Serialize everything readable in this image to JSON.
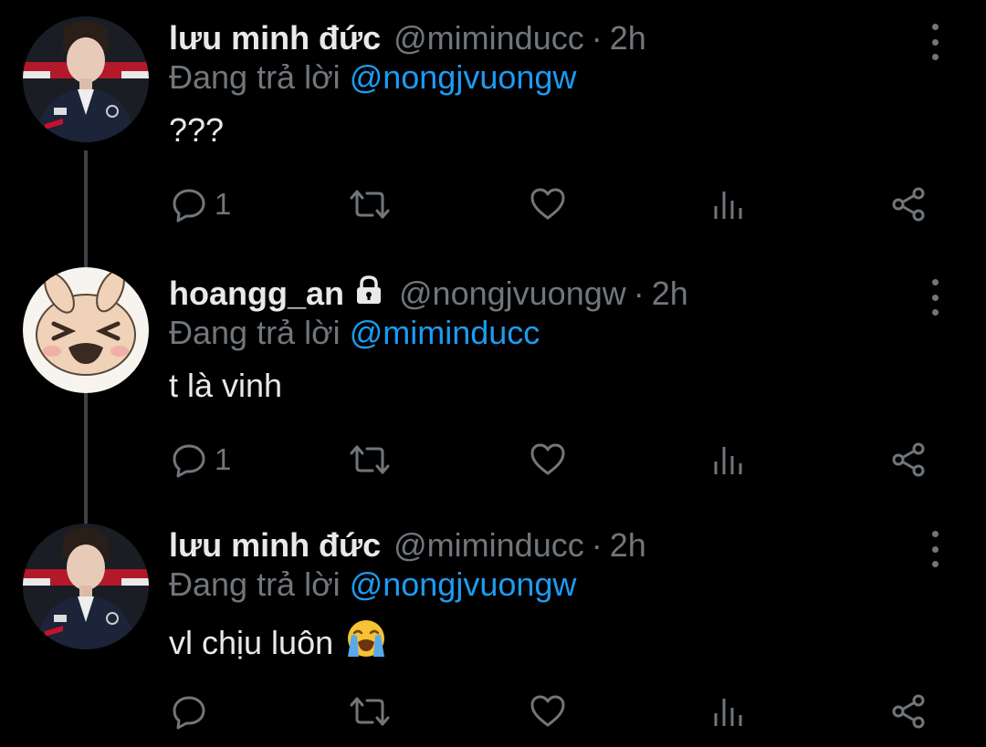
{
  "tweets": [
    {
      "name": "lưu minh đức",
      "handle": "@miminducc",
      "separator": "·",
      "time": "2h",
      "reply_prefix": "Đang trả lời",
      "reply_to": "@nongjvuongw",
      "text": "???",
      "reply_count": "1",
      "locked": false,
      "avatar": "avatar-photo-person"
    },
    {
      "name": "hoangg_an",
      "handle": "@nongjvuongw",
      "separator": "·",
      "time": "2h",
      "reply_prefix": "Đang trả lời",
      "reply_to": "@miminducc",
      "text": "t là vinh",
      "reply_count": "1",
      "locked": true,
      "avatar": "avatar-cartoon-crying"
    },
    {
      "name": "lưu minh đức",
      "handle": "@miminducc",
      "separator": "·",
      "time": "2h",
      "reply_prefix": "Đang trả lời",
      "reply_to": "@nongjvuongw",
      "text": "vl chịu luôn",
      "reply_count": "",
      "locked": false,
      "avatar": "avatar-photo-person",
      "emoji": "loudly-crying-face-emoji"
    }
  ],
  "icons": {
    "reply": "reply-icon",
    "retweet": "retweet-icon",
    "like": "heart-icon",
    "views": "analytics-icon",
    "share": "share-icon",
    "more": "more-options-icon",
    "lock": "lock-icon"
  },
  "colors": {
    "background": "#000000",
    "text": "#e7e9ea",
    "secondary": "#71767b",
    "link": "#1d9bf0",
    "thread_line": "#3e4144"
  }
}
